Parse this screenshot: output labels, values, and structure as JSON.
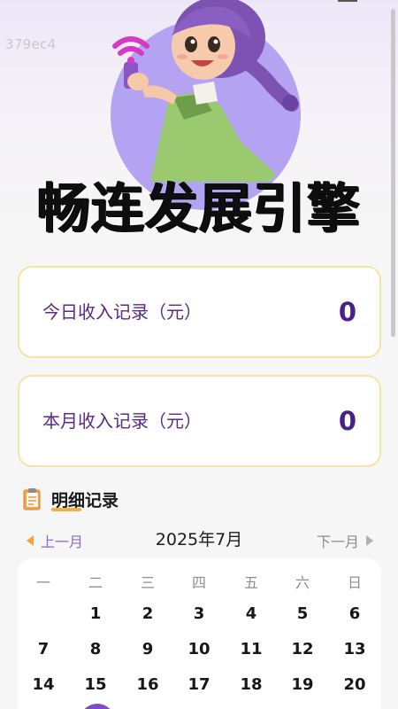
{
  "watermark": "379ec4",
  "app": {
    "title": "畅连发展引擎"
  },
  "cards": {
    "today": {
      "label": "今日收入记录（元）",
      "value": "0"
    },
    "month": {
      "label": "本月收入记录（元）",
      "value": "0"
    }
  },
  "details": {
    "title": "明细记录"
  },
  "calendar": {
    "prev_label": "上一月",
    "month_label": "2025年7月",
    "next_label": "下一月",
    "weekdays": [
      "一",
      "二",
      "三",
      "四",
      "五",
      "六",
      "日"
    ],
    "weeks": [
      [
        "",
        "1",
        "2",
        "3",
        "4",
        "5",
        "6"
      ],
      [
        "7",
        "8",
        "9",
        "10",
        "11",
        "12",
        "13"
      ],
      [
        "14",
        "15",
        "16",
        "17",
        "18",
        "19",
        "20"
      ]
    ]
  },
  "colors": {
    "accent": "#7b4ec9",
    "card_border": "#f6e3a6",
    "value_text": "#4a2089",
    "prev_arrow": "#f5a33f"
  }
}
